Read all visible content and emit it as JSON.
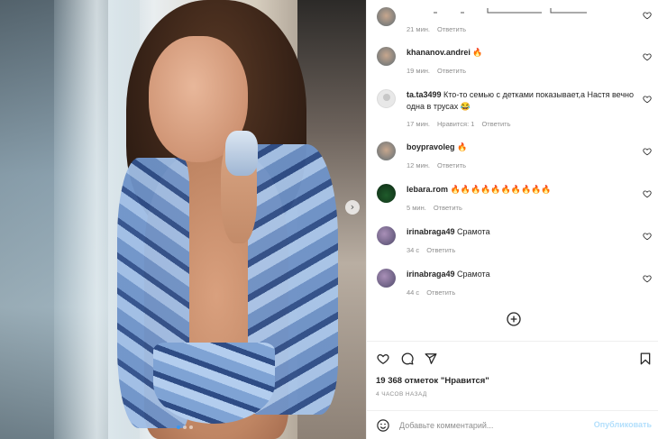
{
  "comments": [
    {
      "user": "",
      "text": "",
      "time": "21 мин.",
      "likes": "",
      "reply": "Ответить",
      "avatar": "face"
    },
    {
      "user": "khananov.andrei",
      "text": "🔥",
      "time": "19 мин.",
      "likes": "",
      "reply": "Ответить",
      "avatar": "face"
    },
    {
      "user": "ta.ta3499",
      "text": "Кто-то семью с детками показывает,а Настя вечно одна в трусах 😂",
      "time": "17 мин.",
      "likes": "Нравится: 1",
      "reply": "Ответить",
      "avatar": "grey"
    },
    {
      "user": "boypravoleg",
      "text": "🔥",
      "time": "12 мин.",
      "likes": "",
      "reply": "Ответить",
      "avatar": "face"
    },
    {
      "user": "lebara.rom",
      "text": "🔥🔥🔥🔥🔥🔥🔥🔥🔥🔥",
      "time": "5 мин.",
      "likes": "",
      "reply": "Ответить",
      "avatar": "green"
    },
    {
      "user": "irinabraga49",
      "text": "Срамота",
      "time": "34 с",
      "likes": "",
      "reply": "Ответить",
      "avatar": "purple"
    },
    {
      "user": "irinabraga49",
      "text": "Срамота",
      "time": "44 с",
      "likes": "",
      "reply": "Ответить",
      "avatar": "purple"
    }
  ],
  "likes_count": "19 368 отметок \"Нравится\"",
  "posted_time": "4 часов назад",
  "composer": {
    "placeholder": "Добавьте комментарий...",
    "publish_label": "Опубликовать"
  },
  "carousel": {
    "next_glyph": "›",
    "slide_count": 3,
    "active_slide": 1
  },
  "icons": {
    "like": "heart-icon",
    "comment": "comment-icon",
    "share": "paper-plane-icon",
    "save": "bookmark-icon",
    "emoji": "smiley-icon",
    "load_more": "plus-circle-icon",
    "next": "chevron-right-icon",
    "comment_like": "heart-icon"
  },
  "colors": {
    "accent": "#3897f0",
    "publish_disabled": "#b2dffc",
    "meta": "#8e8e8e",
    "text": "#262626"
  }
}
